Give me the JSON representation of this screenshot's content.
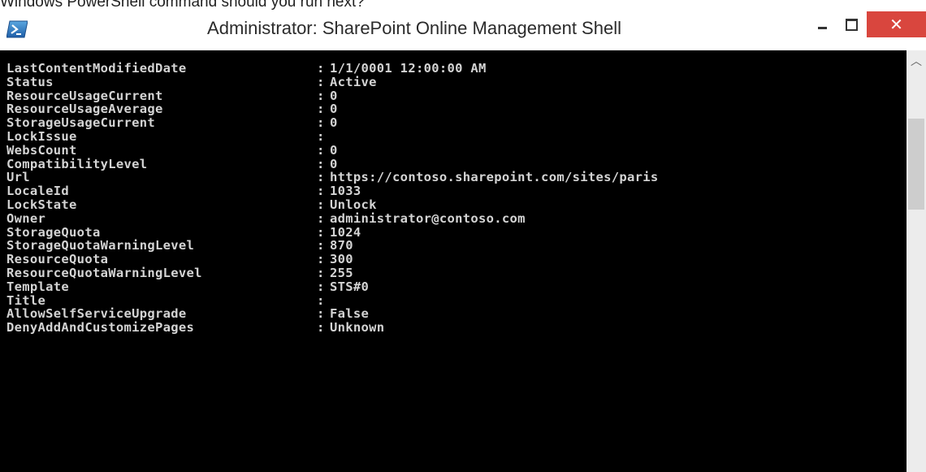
{
  "caption": "Windows PowerShell command should you run next?",
  "window": {
    "title": "Administrator: SharePoint Online Management Shell",
    "icon": "powershell-icon",
    "controls": {
      "minimize": "minimize-icon",
      "maximize": "maximize-icon",
      "close": "close-icon"
    },
    "close_color": "#d9463e"
  },
  "console": {
    "background": "#000000",
    "foreground": "#d4d4d4",
    "rows": [
      {
        "key": "LastContentModifiedDate",
        "sep": ":",
        "value": "1/1/0001 12:00:00 AM"
      },
      {
        "key": "Status",
        "sep": ":",
        "value": "Active"
      },
      {
        "key": "ResourceUsageCurrent",
        "sep": ":",
        "value": "0"
      },
      {
        "key": "ResourceUsageAverage",
        "sep": ":",
        "value": "0"
      },
      {
        "key": "StorageUsageCurrent",
        "sep": ":",
        "value": "0"
      },
      {
        "key": "LockIssue",
        "sep": ":",
        "value": ""
      },
      {
        "key": "WebsCount",
        "sep": ":",
        "value": "0"
      },
      {
        "key": "CompatibilityLevel",
        "sep": ":",
        "value": "0"
      },
      {
        "key": "Url",
        "sep": ":",
        "value": "https://contoso.sharepoint.com/sites/paris"
      },
      {
        "key": "LocaleId",
        "sep": ":",
        "value": "1033"
      },
      {
        "key": "LockState",
        "sep": ":",
        "value": "Unlock"
      },
      {
        "key": "Owner",
        "sep": ":",
        "value": "administrator@contoso.com"
      },
      {
        "key": "StorageQuota",
        "sep": ":",
        "value": "1024"
      },
      {
        "key": "StorageQuotaWarningLevel",
        "sep": ":",
        "value": "870"
      },
      {
        "key": "ResourceQuota",
        "sep": ":",
        "value": "300"
      },
      {
        "key": "ResourceQuotaWarningLevel",
        "sep": ":",
        "value": "255"
      },
      {
        "key": "Template",
        "sep": ":",
        "value": "STS#0"
      },
      {
        "key": "Title",
        "sep": ":",
        "value": ""
      },
      {
        "key": "AllowSelfServiceUpgrade",
        "sep": ":",
        "value": "False"
      },
      {
        "key": "DenyAddAndCustomizePages",
        "sep": ":",
        "value": "Unknown"
      }
    ]
  },
  "scrollbar": {
    "up_icon": "scroll-up-arrow-icon"
  }
}
